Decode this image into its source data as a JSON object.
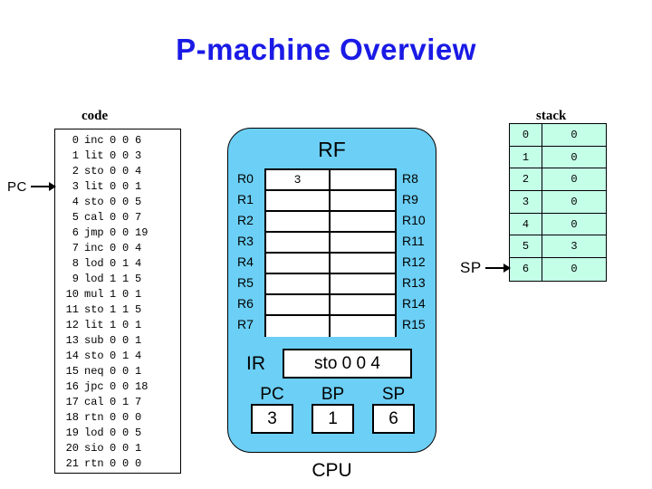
{
  "title": "P-machine Overview",
  "code": {
    "caption": "code",
    "pointer": {
      "label": "PC",
      "target_line": 3,
      "icon": "arrow-right-icon"
    },
    "columns": [
      "addr",
      "op",
      "f1",
      "f2",
      "f3"
    ],
    "lines": [
      {
        "addr": "0",
        "op": "inc",
        "f1": "0",
        "f2": "0",
        "f3": "6"
      },
      {
        "addr": "1",
        "op": "lit",
        "f1": "0",
        "f2": "0",
        "f3": "3"
      },
      {
        "addr": "2",
        "op": "sto",
        "f1": "0",
        "f2": "0",
        "f3": "4"
      },
      {
        "addr": "3",
        "op": "lit",
        "f1": "0",
        "f2": "0",
        "f3": "1"
      },
      {
        "addr": "4",
        "op": "sto",
        "f1": "0",
        "f2": "0",
        "f3": "5"
      },
      {
        "addr": "5",
        "op": "cal",
        "f1": "0",
        "f2": "0",
        "f3": "7"
      },
      {
        "addr": "6",
        "op": "jmp",
        "f1": "0",
        "f2": "0",
        "f3": "19"
      },
      {
        "addr": "7",
        "op": "inc",
        "f1": "0",
        "f2": "0",
        "f3": "4"
      },
      {
        "addr": "8",
        "op": "lod",
        "f1": "0",
        "f2": "1",
        "f3": "4"
      },
      {
        "addr": "9",
        "op": "lod",
        "f1": "1",
        "f2": "1",
        "f3": "5"
      },
      {
        "addr": "10",
        "op": "mul",
        "f1": "1",
        "f2": "0",
        "f3": "1"
      },
      {
        "addr": "11",
        "op": "sto",
        "f1": "1",
        "f2": "1",
        "f3": "5"
      },
      {
        "addr": "12",
        "op": "lit",
        "f1": "1",
        "f2": "0",
        "f3": "1"
      },
      {
        "addr": "13",
        "op": "sub",
        "f1": "0",
        "f2": "0",
        "f3": "1"
      },
      {
        "addr": "14",
        "op": "sto",
        "f1": "0",
        "f2": "1",
        "f3": "4"
      },
      {
        "addr": "15",
        "op": "neq",
        "f1": "0",
        "f2": "0",
        "f3": "1"
      },
      {
        "addr": "16",
        "op": "jpc",
        "f1": "0",
        "f2": "0",
        "f3": "18"
      },
      {
        "addr": "17",
        "op": "cal",
        "f1": "0",
        "f2": "1",
        "f3": "7"
      },
      {
        "addr": "18",
        "op": "rtn",
        "f1": "0",
        "f2": "0",
        "f3": "0"
      },
      {
        "addr": "19",
        "op": "lod",
        "f1": "0",
        "f2": "0",
        "f3": "5"
      },
      {
        "addr": "20",
        "op": "sio",
        "f1": "0",
        "f2": "0",
        "f3": "1"
      },
      {
        "addr": "21",
        "op": "rtn",
        "f1": "0",
        "f2": "0",
        "f3": "0"
      }
    ]
  },
  "cpu": {
    "caption": "CPU",
    "box_color": "#6ccff5",
    "rf": {
      "title": "RF",
      "rows": [
        {
          "left_label": "R0",
          "left_value": "3",
          "right_label": "R8",
          "right_value": ""
        },
        {
          "left_label": "R1",
          "left_value": "",
          "right_label": "R9",
          "right_value": ""
        },
        {
          "left_label": "R2",
          "left_value": "",
          "right_label": "R10",
          "right_value": ""
        },
        {
          "left_label": "R3",
          "left_value": "",
          "right_label": "R11",
          "right_value": ""
        },
        {
          "left_label": "R4",
          "left_value": "",
          "right_label": "R12",
          "right_value": ""
        },
        {
          "left_label": "R5",
          "left_value": "",
          "right_label": "R13",
          "right_value": ""
        },
        {
          "left_label": "R6",
          "left_value": "",
          "right_label": "R14",
          "right_value": ""
        },
        {
          "left_label": "R7",
          "left_value": "",
          "right_label": "R15",
          "right_value": ""
        }
      ]
    },
    "ir": {
      "label": "IR",
      "value": "sto 0 0 4"
    },
    "registers": [
      {
        "name": "PC",
        "value": "3"
      },
      {
        "name": "BP",
        "value": "1"
      },
      {
        "name": "SP",
        "value": "6"
      }
    ]
  },
  "stack": {
    "caption": "stack",
    "cell_color": "#c4ffe8",
    "pointer": {
      "label": "SP",
      "target_index": "6",
      "icon": "arrow-right-icon"
    },
    "rows": [
      {
        "index": "0",
        "value": "0"
      },
      {
        "index": "1",
        "value": "0"
      },
      {
        "index": "2",
        "value": "0"
      },
      {
        "index": "3",
        "value": "0"
      },
      {
        "index": "4",
        "value": "0"
      },
      {
        "index": "5",
        "value": "3"
      },
      {
        "index": "6",
        "value": "0"
      }
    ]
  }
}
